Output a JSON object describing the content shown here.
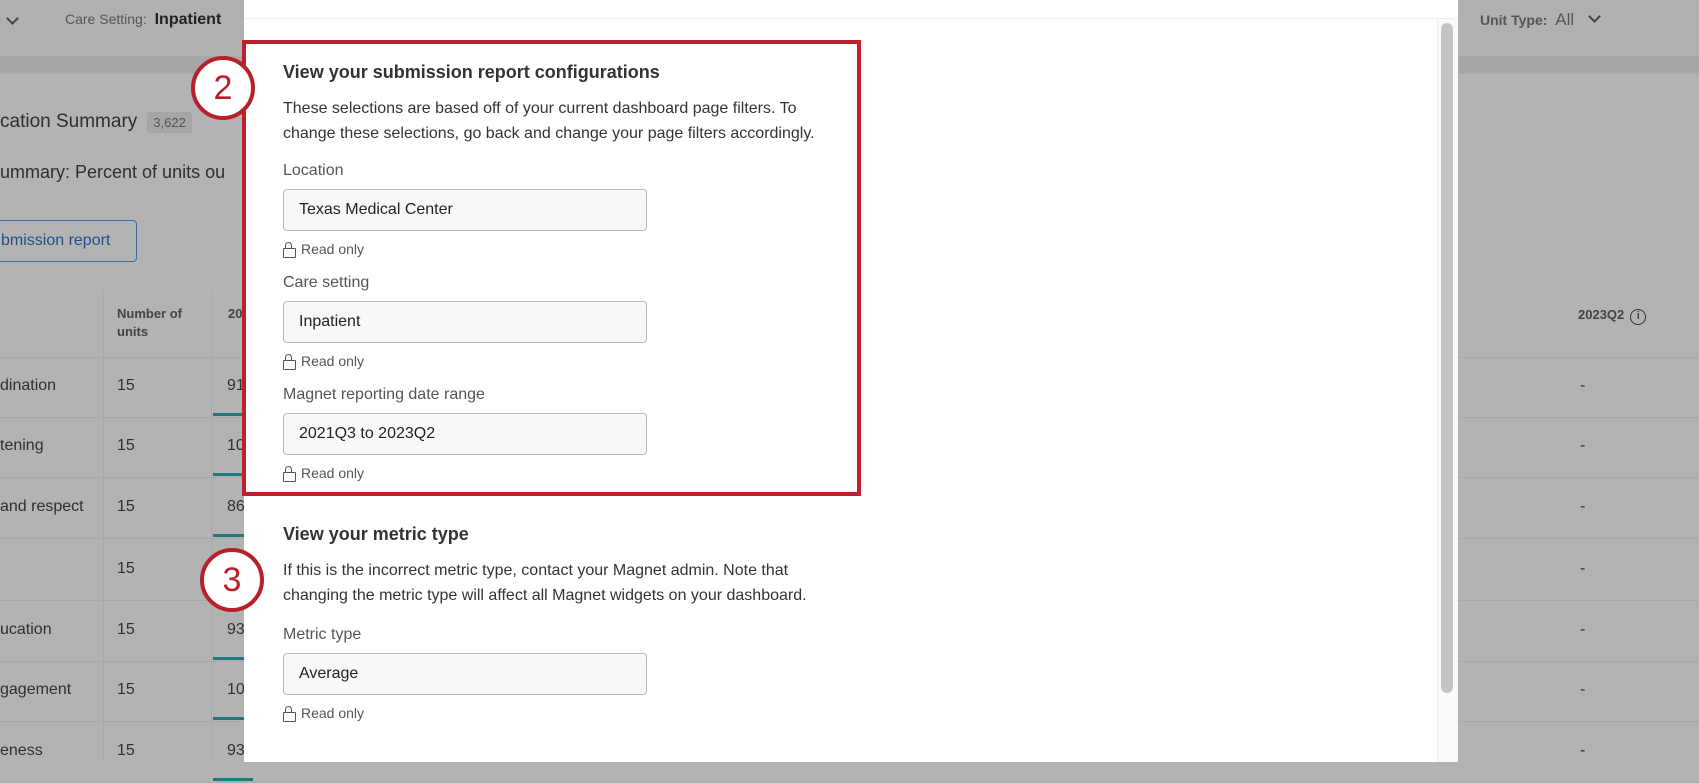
{
  "background": {
    "care_setting_label": "Care Setting:",
    "care_setting_value": "Inpatient",
    "unit_type_label": "Unit Type:",
    "unit_type_value": "All",
    "widget_title": "cation Summary",
    "widget_count": "3,622",
    "widget_subtitle": "ummary: Percent of units ou",
    "submission_button": "bmission report",
    "table": {
      "header_units": "Number of units",
      "header_col3": "20",
      "header_last": "2023Q2",
      "rows": [
        {
          "label": "dination",
          "units": "15",
          "col3": "91",
          "last": "-"
        },
        {
          "label": "tening",
          "units": "15",
          "col3": "10",
          "last": "-"
        },
        {
          "label": "and respect",
          "units": "15",
          "col3": "86",
          "last": "-"
        },
        {
          "label": "",
          "units": "15",
          "col3": "",
          "last": "-"
        },
        {
          "label": "ucation",
          "units": "15",
          "col3": "93",
          "last": "-"
        },
        {
          "label": "gagement",
          "units": "15",
          "col3": "10",
          "last": "-"
        },
        {
          "label": "eness",
          "units": "15",
          "col3": "93",
          "last": "-"
        }
      ]
    }
  },
  "panel": {
    "step2": "2",
    "step3": "3",
    "section1": {
      "title": "View your submission report configurations",
      "description": "These selections are based off of your current dashboard page filters. To change these selections, go back and change your page filters accordingly.",
      "fields": [
        {
          "label": "Location",
          "value": "Texas Medical Center",
          "note": "Read only"
        },
        {
          "label": "Care setting",
          "value": "Inpatient",
          "note": "Read only"
        },
        {
          "label": "Magnet reporting date range",
          "value": "2021Q3 to 2023Q2",
          "note": "Read only"
        }
      ]
    },
    "section2": {
      "title": "View your metric type",
      "description": "If this is the incorrect metric type, contact your Magnet admin. Note that changing the metric type will affect all Magnet widgets on your dashboard.",
      "field": {
        "label": "Metric type",
        "value": "Average",
        "note": "Read only"
      }
    }
  },
  "colors": {
    "annotation": "#c0202e",
    "teal": "#1d7b7b"
  }
}
